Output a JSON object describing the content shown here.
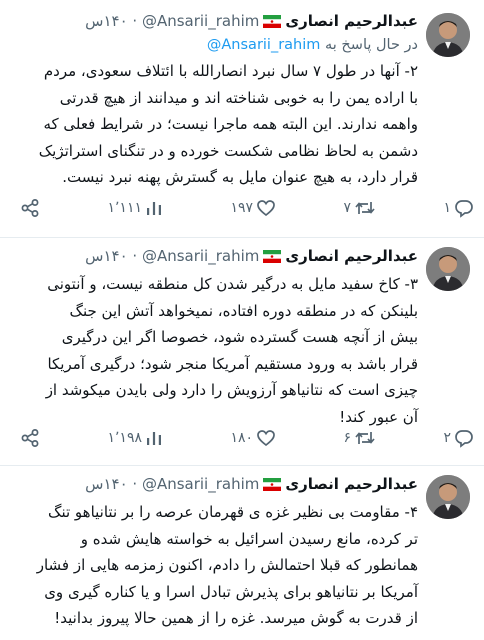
{
  "tweets": [
    {
      "author_name": "عبدالرحیم انصاری",
      "handle": "@Ansarii_rahim",
      "time": "۱۴۰س",
      "replying_prefix": "در حال پاسخ به",
      "replying_mention": "@Ansarii_rahim",
      "lines": [
        "۲- آنها در طول ۷ سال نبرد انصارالله با ائتلاف سعودی، مردم",
        "با اراده یمن را به خوبی شناخته اند و میدانند از هیچ قدرتی",
        "واهمه ندارند. این البته همه ماجرا نیست؛ در شرایط فعلی که",
        "دشمن به لحاظ نظامی شکست خورده و در تنگنای استراتژیک",
        "قرار دارد، به هیچ عنوان مایل به گسترش پهنه نبرد نیست."
      ],
      "stats": {
        "views": "۱٬۱۱۱",
        "likes": "۱۹۷",
        "retweets": "۷",
        "replies": "۱"
      }
    },
    {
      "author_name": "عبدالرحیم انصاری",
      "handle": "@Ansarii_rahim",
      "time": "۱۴۰س",
      "lines": [
        "۳- کاخ سفید مایل به درگیر شدن کل منطقه نیست، و آنتونی",
        "بلینکن که در منطقه دوره افتاده، نمیخواهد آتش این جنگ",
        "بیش از آنچه هست گسترده شود، خصوصا اگر این درگیری",
        "قرار باشد به ورود مستقیم آمریکا منجر شود؛ درگیری آمریکا",
        "چیزی است که نتانیاهو آرزویش را دارد ولی بایدن میکوشد از",
        "آن عبور کند!"
      ],
      "stats": {
        "views": "۱٬۱۹۸",
        "likes": "۱۸۰",
        "retweets": "۶",
        "replies": "۲"
      }
    },
    {
      "author_name": "عبدالرحیم انصاری",
      "handle": "@Ansarii_rahim",
      "time": "۱۴۰س",
      "lines": [
        "۴- مقاومت بی نظیر غزه ی قهرمان عرصه را بر نتانیاهو تنگ",
        "تر کرده، مانع رسیدن اسرائیل به خواسته هایش شده و",
        "همانطور که قبلا احتمالش را دادم، اکنون زمزمه هایی از فشار",
        "آمریکا بر نتانیاهو برای پذیرش تبادل اسرا و یا کناره گیری وی",
        "از قدرت به گوش میرسد. غزه را از همین حالا پیروز بدانید!"
      ]
    }
  ]
}
